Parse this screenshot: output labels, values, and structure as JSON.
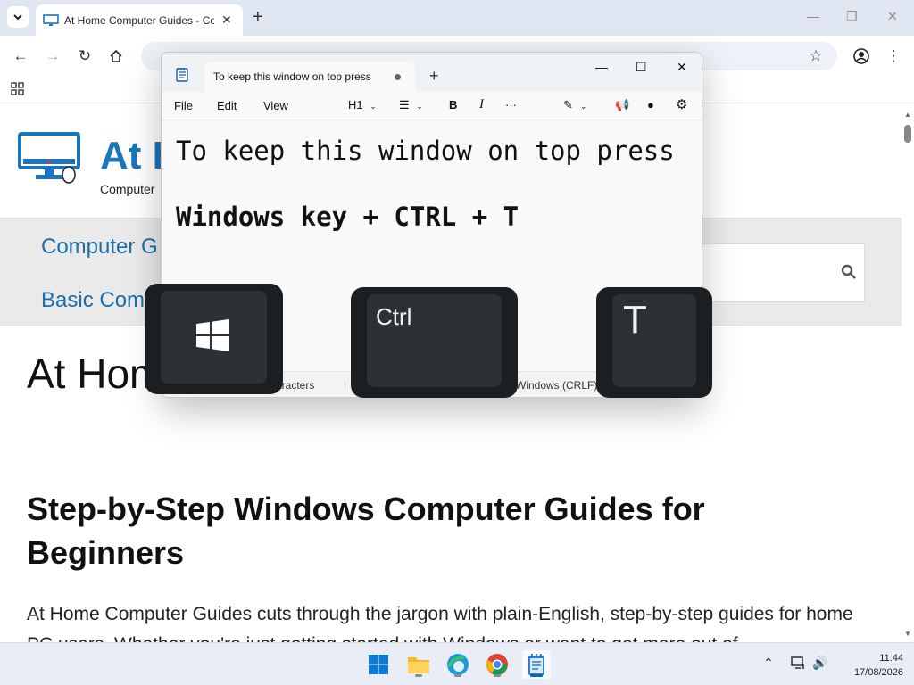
{
  "browser": {
    "tab_title": "At Home Computer Guides - Co",
    "new_tab_symbol": "+",
    "window_controls": {
      "minimize": "—",
      "restore": "❐",
      "close": "✕"
    }
  },
  "site": {
    "logo_title": "At H",
    "logo_subtitle": "Computer",
    "nav": [
      "Computer G",
      "Basic Com"
    ],
    "page_title": "At Hom",
    "heading": "Step-by-Step Windows Computer Guides for Beginners",
    "paragraph": "At Home Computer Guides cuts through the jargon with plain-English, step-by-step guides for home PC users. Whether you're just getting started with Windows or want to get more out of"
  },
  "notepad": {
    "tab_title": "To keep this window on top press",
    "new_tab_symbol": "+",
    "window_controls": {
      "minimize": "—",
      "maximize": "☐",
      "close": "✕"
    },
    "menu": {
      "file": "File",
      "edit": "Edit",
      "view": "View"
    },
    "toolbar": {
      "heading": "H1",
      "bold": "B",
      "italic": "I",
      "more": "···"
    },
    "lines": [
      "To keep this window on top press",
      "Windows key + CTRL + T"
    ],
    "status": {
      "characters": "aracters",
      "encoding": "Windows (CRLF)"
    }
  },
  "keys": {
    "ctrl": "Ctrl",
    "t": "T"
  },
  "taskbar": {
    "apps": [
      "start-icon",
      "file-explorer-icon",
      "edge-icon",
      "chrome-icon",
      "notepad-icon"
    ],
    "time": "11:44",
    "date": "17/08/2026"
  },
  "colors": {
    "accent": "#1b75bb",
    "taskbar_accent": "#0067c0",
    "key_bg": "#1c1f22"
  }
}
